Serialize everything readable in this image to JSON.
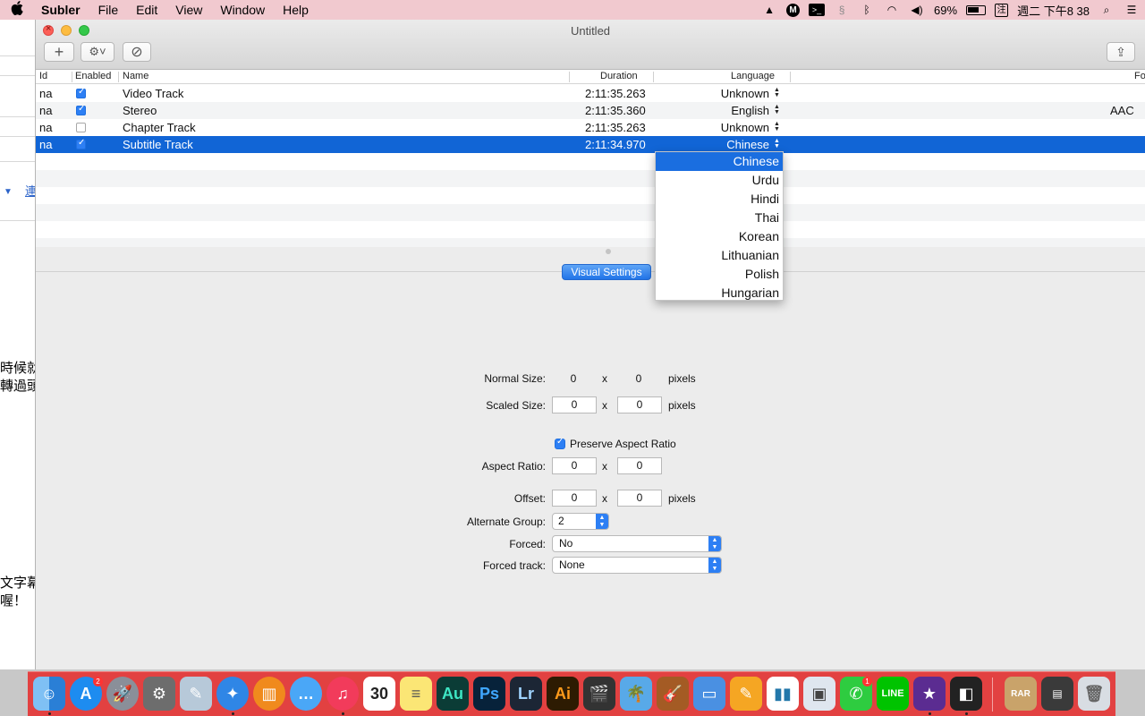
{
  "menubar": {
    "apple": "",
    "app_name": "Subler",
    "items": [
      "File",
      "Edit",
      "View",
      "Window",
      "Help"
    ],
    "battery_percent": "69%",
    "clock": "週二 下午8 38",
    "input_method": "注"
  },
  "window": {
    "title": "Untitled",
    "toolbar": {
      "add_label": "+",
      "gear_label": "⚙︎˅",
      "cancel_label": "⊘",
      "share_label": "⇪"
    }
  },
  "table": {
    "headers": {
      "id": "Id",
      "enabled": "Enabled",
      "name": "Name",
      "duration": "Duration",
      "language": "Language",
      "format": "Fo"
    },
    "rows": [
      {
        "id": "na",
        "enabled": true,
        "name": "Video Track",
        "duration": "2:11:35.263",
        "language": "Unknown",
        "format": ""
      },
      {
        "id": "na",
        "enabled": true,
        "name": "Stereo",
        "duration": "2:11:35.360",
        "language": "English",
        "format": "AAC"
      },
      {
        "id": "na",
        "enabled": false,
        "name": "Chapter Track",
        "duration": "2:11:35.263",
        "language": "Unknown",
        "format": ""
      },
      {
        "id": "na",
        "enabled": true,
        "name": "Subtitle Track",
        "duration": "2:11:34.970",
        "language": "Chinese",
        "format": "",
        "selected": true
      }
    ]
  },
  "language_menu": {
    "options": [
      "Chinese",
      "Urdu",
      "Hindi",
      "Thai",
      "Korean",
      "Lithuanian",
      "Polish",
      "Hungarian"
    ],
    "highlighted": "Chinese"
  },
  "visual_settings": {
    "tab_label": "Visual Settings",
    "normal_size": {
      "label": "Normal Size:",
      "width": "0",
      "height": "0",
      "unit": "pixels"
    },
    "scaled_size": {
      "label": "Scaled Size:",
      "width": "0",
      "height": "0",
      "unit": "pixels"
    },
    "preserve_aspect_label": "Preserve Aspect Ratio",
    "preserve_aspect_checked": true,
    "aspect_ratio": {
      "label": "Aspect Ratio:",
      "width": "0",
      "height": "0"
    },
    "offset": {
      "label": "Offset:",
      "x": "0",
      "y": "0",
      "unit": "pixels"
    },
    "alternate_group": {
      "label": "Alternate Group:",
      "value": "2"
    },
    "forced": {
      "label": "Forced:",
      "value": "No"
    },
    "forced_track": {
      "label": "Forced track:",
      "value": "None"
    },
    "x_separator": "x"
  },
  "background_window": {
    "texts": [
      "時候就",
      "轉過頭",
      "文字幕",
      "喔！",
      "連"
    ]
  },
  "dock": {
    "apps": [
      "finder",
      "app-store",
      "launchpad",
      "system-preferences",
      "preview",
      "safari",
      "ibooks",
      "messages",
      "itunes",
      "calendar",
      "notes",
      "audition",
      "photoshop",
      "lightroom",
      "illustrator",
      "final-cut-pro",
      "iphoto",
      "garageband",
      "keynote",
      "pages",
      "numbers",
      "photo-booth",
      "facetime",
      "line",
      "imovie",
      "dvd-player",
      "rar",
      "video-converter",
      "trash"
    ],
    "labels": {
      "audition": "Au",
      "photoshop": "Ps",
      "lightroom": "Lr",
      "illustrator": "Ai",
      "calendar": "30",
      "appstore_badge": "2",
      "facetime_badge": "1"
    }
  }
}
